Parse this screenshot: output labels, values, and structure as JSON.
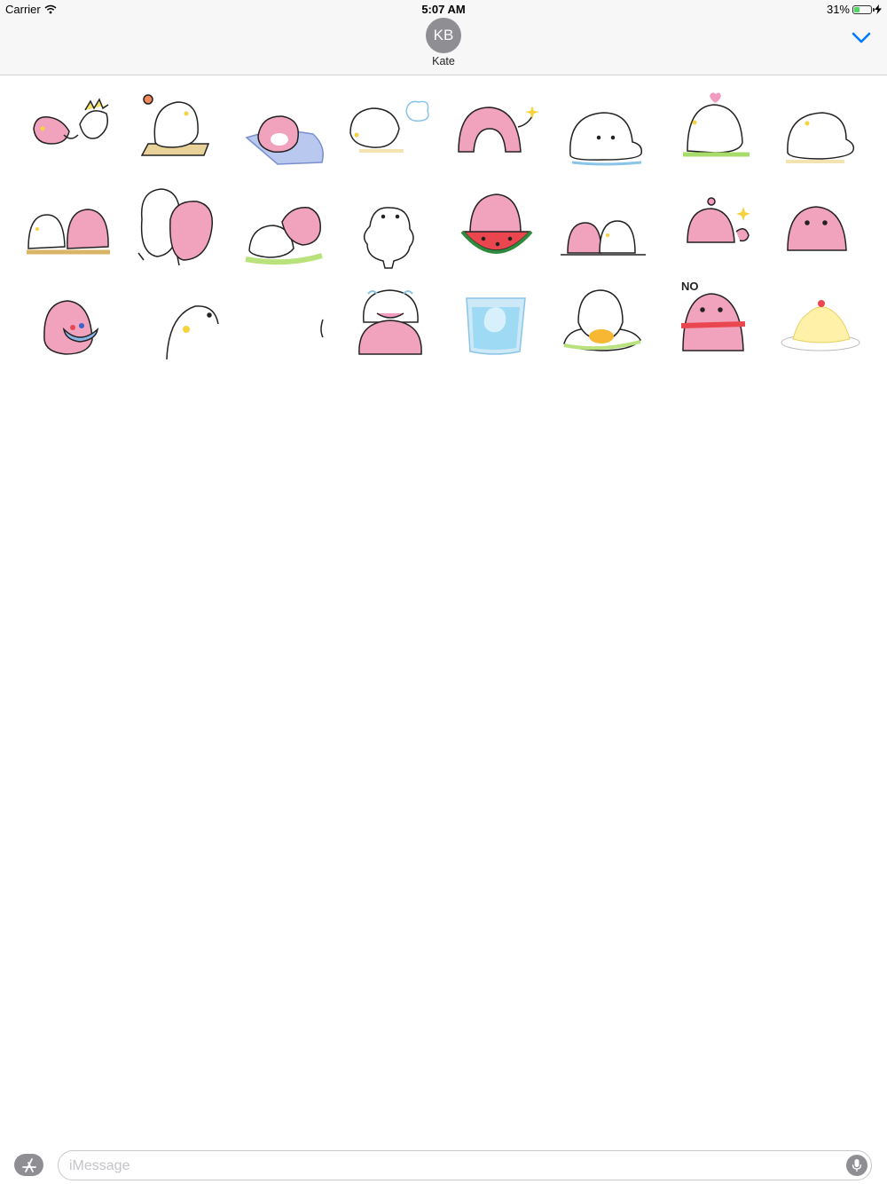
{
  "status_bar": {
    "carrier": "Carrier",
    "time": "5:07 AM",
    "battery_percent": "31%",
    "battery_level": 0.31,
    "wifi_icon": "wifi-icon",
    "charging_icon": "bolt-icon"
  },
  "header": {
    "avatar_initials": "KB",
    "contact_name": "Kate",
    "collapse_icon": "chevron-down-icon",
    "accent_color": "#007aff"
  },
  "stickers": [
    {
      "id": "seal-pink-punched"
    },
    {
      "id": "seal-white-sitting-mat"
    },
    {
      "id": "seal-pink-sliding"
    },
    {
      "id": "seal-white-blowing-cloud"
    },
    {
      "id": "seal-pink-arch-wave"
    },
    {
      "id": "seal-white-lying"
    },
    {
      "id": "seal-white-heart"
    },
    {
      "id": "seal-white-blob"
    },
    {
      "id": "seals-eating-together"
    },
    {
      "id": "seals-hugging"
    },
    {
      "id": "seals-lying-grass"
    },
    {
      "id": "seal-white-standing"
    },
    {
      "id": "seal-pink-watermelon"
    },
    {
      "id": "seals-peeking"
    },
    {
      "id": "seal-pink-flower-sparkle"
    },
    {
      "id": "seal-pink-arch-grumpy"
    },
    {
      "id": "seal-pink-bowl"
    },
    {
      "id": "seal-white-peek-side"
    },
    {
      "id": "seal-edge"
    },
    {
      "id": "seals-stacked-crying"
    },
    {
      "id": "seal-in-glass"
    },
    {
      "id": "seal-white-egg"
    },
    {
      "id": "seal-pink-no",
      "text": "NO"
    },
    {
      "id": "pudding-dessert"
    }
  ],
  "input": {
    "placeholder": "iMessage",
    "appstore_icon": "app-store-icon",
    "mic_icon": "microphone-icon"
  },
  "colors": {
    "pink": "#f1a2bd",
    "white_seal": "#ffffff",
    "blush": "#f6d23c",
    "battery_green": "#4cd964"
  }
}
